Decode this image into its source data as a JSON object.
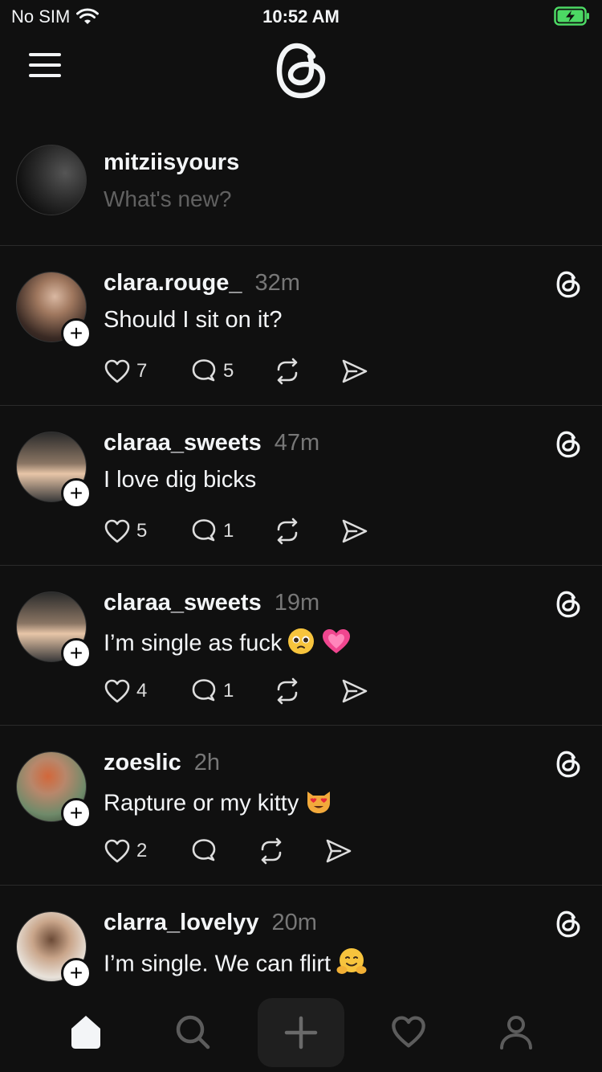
{
  "status_bar": {
    "carrier": "No SIM",
    "time": "10:52 AM"
  },
  "composer": {
    "username": "mitziisyours",
    "placeholder": "What's new?"
  },
  "posts": [
    {
      "username": "clara.rouge_",
      "time": "32m",
      "text": "Should I sit on it?",
      "likes": "7",
      "replies": "5",
      "emoji": []
    },
    {
      "username": "claraa_sweets",
      "time": "47m",
      "text": "I love dig bicks",
      "likes": "5",
      "replies": "1",
      "emoji": []
    },
    {
      "username": "claraa_sweets",
      "time": "19m",
      "text": "I’m single as fuck",
      "likes": "4",
      "replies": "1",
      "emoji": [
        "pleading-face-emoji",
        "growing-heart-emoji"
      ]
    },
    {
      "username": "zoeslic",
      "time": "2h",
      "text": "Rapture or my kitty",
      "likes": "2",
      "replies": "",
      "emoji": [
        "heart-eyes-cat-emoji"
      ]
    },
    {
      "username": "clarra_lovelyy",
      "time": "20m",
      "text": "I’m single. We can flirt",
      "likes": "",
      "replies": "",
      "emoji": [
        "hugging-face-emoji"
      ]
    }
  ],
  "icons": {
    "menu": "menu-icon",
    "logo": "threads-logo-icon",
    "like": "heart-icon",
    "reply": "comment-icon",
    "repost": "repost-icon",
    "share": "send-icon",
    "tab_home": "home-icon",
    "tab_search": "search-icon",
    "tab_create": "plus-icon",
    "tab_activity": "heart-icon",
    "tab_profile": "profile-icon"
  },
  "colors": {
    "background": "#101010",
    "text": "#f3f5f7",
    "muted": "#777777",
    "battery": "#4cd964"
  }
}
